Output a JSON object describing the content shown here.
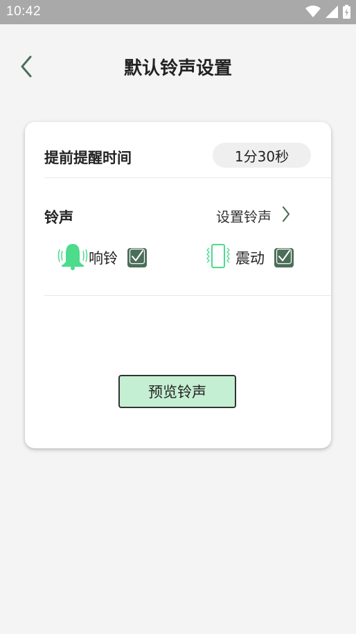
{
  "status_bar": {
    "time": "10:42",
    "icons": [
      "wifi-icon",
      "signal-icon",
      "battery-charging-icon"
    ]
  },
  "header": {
    "title": "默认铃声设置",
    "back_icon": "chevron-left-icon"
  },
  "advance_reminder": {
    "label": "提前提醒时间",
    "value": "1分30秒"
  },
  "ringtone": {
    "label": "铃声",
    "set_label": "设置铃声"
  },
  "options": {
    "ring": {
      "label": "响铃",
      "checked": true,
      "icon": "bell-ringing-icon"
    },
    "vibrate": {
      "label": "震动",
      "checked": true,
      "icon": "phone-vibrate-icon"
    }
  },
  "preview_button": {
    "label": "预览铃声"
  },
  "colors": {
    "accent_green": "#4ddb8c",
    "checkbox": "#4b6e59",
    "button_bg": "#c5efd2",
    "back_arrow": "#4b6e59"
  }
}
